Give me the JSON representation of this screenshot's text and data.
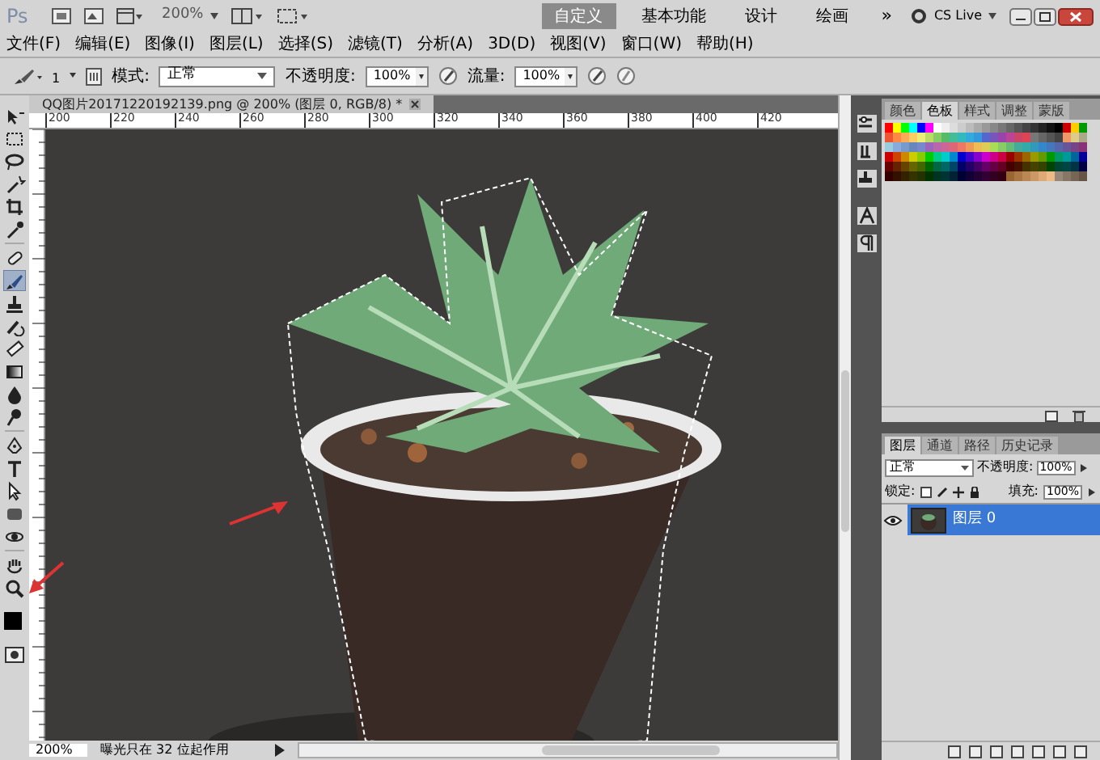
{
  "app": {
    "logo": "Ps",
    "zoom": "200%",
    "workspaces": [
      {
        "label": "自定义",
        "selected": true
      },
      {
        "label": "基本功能",
        "selected": false
      },
      {
        "label": "设计",
        "selected": false
      },
      {
        "label": "绘画",
        "selected": false
      }
    ],
    "more": "»",
    "cs_live": "CS Live"
  },
  "menu": [
    "文件(F)",
    "编辑(E)",
    "图像(I)",
    "图层(L)",
    "选择(S)",
    "滤镜(T)",
    "分析(A)",
    "3D(D)",
    "视图(V)",
    "窗口(W)",
    "帮助(H)"
  ],
  "options": {
    "brush_size": "1",
    "mode_label": "模式:",
    "mode": "正常",
    "opacity_label": "不透明度:",
    "opacity": "100%",
    "flow_label": "流量:",
    "flow": "100%"
  },
  "document": {
    "tab_title": "QQ图片20171220192139.png @ 200% (图层 0, RGB/8) *",
    "ruler_ticks": [
      "200",
      "220",
      "240",
      "260",
      "280",
      "300",
      "320",
      "340",
      "360",
      "380",
      "400",
      "420"
    ]
  },
  "tools": [
    {
      "kind": "move",
      "selected": false
    },
    {
      "kind": "marquee",
      "selected": false
    },
    {
      "kind": "lasso",
      "selected": false
    },
    {
      "kind": "wand",
      "selected": false
    },
    {
      "kind": "crop",
      "selected": false
    },
    {
      "kind": "eyedropper",
      "selected": false
    },
    {
      "kind": "healing",
      "selected": false
    },
    {
      "kind": "brush",
      "selected": true
    },
    {
      "kind": "stamp",
      "selected": false
    },
    {
      "kind": "history",
      "selected": false
    },
    {
      "kind": "eraser",
      "selected": false
    },
    {
      "kind": "gradient",
      "selected": false
    },
    {
      "kind": "blur",
      "selected": false
    },
    {
      "kind": "dodge",
      "selected": false
    },
    {
      "kind": "pen",
      "selected": false
    },
    {
      "kind": "type",
      "selected": false
    },
    {
      "kind": "path",
      "selected": false
    },
    {
      "kind": "shape",
      "selected": false
    },
    {
      "kind": "rotate3d",
      "selected": false
    },
    {
      "kind": "hand",
      "selected": false
    },
    {
      "kind": "zoom",
      "selected": false
    }
  ],
  "status_bar": {
    "zoom": "200%",
    "info": "曝光只在 32 位起作用"
  },
  "swatch_panel": {
    "tabs": [
      {
        "label": "颜色",
        "selected": false
      },
      {
        "label": "色板",
        "selected": true
      },
      {
        "label": "样式",
        "selected": false
      },
      {
        "label": "调整",
        "selected": false
      },
      {
        "label": "蒙版",
        "selected": false
      }
    ]
  },
  "layers_panel": {
    "tabs": [
      {
        "label": "图层",
        "selected": true
      },
      {
        "label": "通道",
        "selected": false
      },
      {
        "label": "路径",
        "selected": false
      },
      {
        "label": "历史记录",
        "selected": false
      }
    ],
    "blend_mode": "正常",
    "opacity_label": "不透明度:",
    "opacity": "100%",
    "lock_label": "锁定:",
    "fill_label": "填充:",
    "fill": "100%",
    "layers": [
      {
        "name": "图层 0",
        "selected": true,
        "visible": true
      }
    ]
  }
}
